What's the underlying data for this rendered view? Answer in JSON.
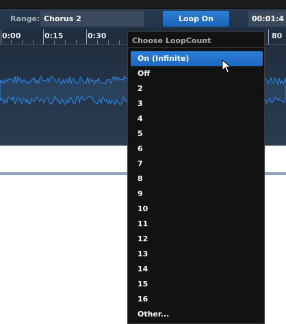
{
  "toolbar": {
    "range_label": "Range:",
    "range_value": "Chorus 2",
    "loop_button_label": "Loop On",
    "time_value": "00:01:4"
  },
  "ruler": {
    "labels": [
      "0:00",
      "0:15",
      "0:30"
    ],
    "right_label": "80"
  },
  "dropdown": {
    "title": "Choose LoopCount",
    "items": [
      "On (Infinite)",
      "Off",
      "2",
      "3",
      "4",
      "5",
      "6",
      "7",
      "8",
      "9",
      "10",
      "11",
      "12",
      "13",
      "14",
      "15",
      "16",
      "Other..."
    ],
    "selected_index": 0
  },
  "colors": {
    "accent": "#2d7ed8",
    "waveform": "#2b8cf0",
    "toolbar_bg": "#26364a",
    "menu_bg": "#121212"
  },
  "icons": {
    "cursor": "mouse-pointer-icon"
  }
}
